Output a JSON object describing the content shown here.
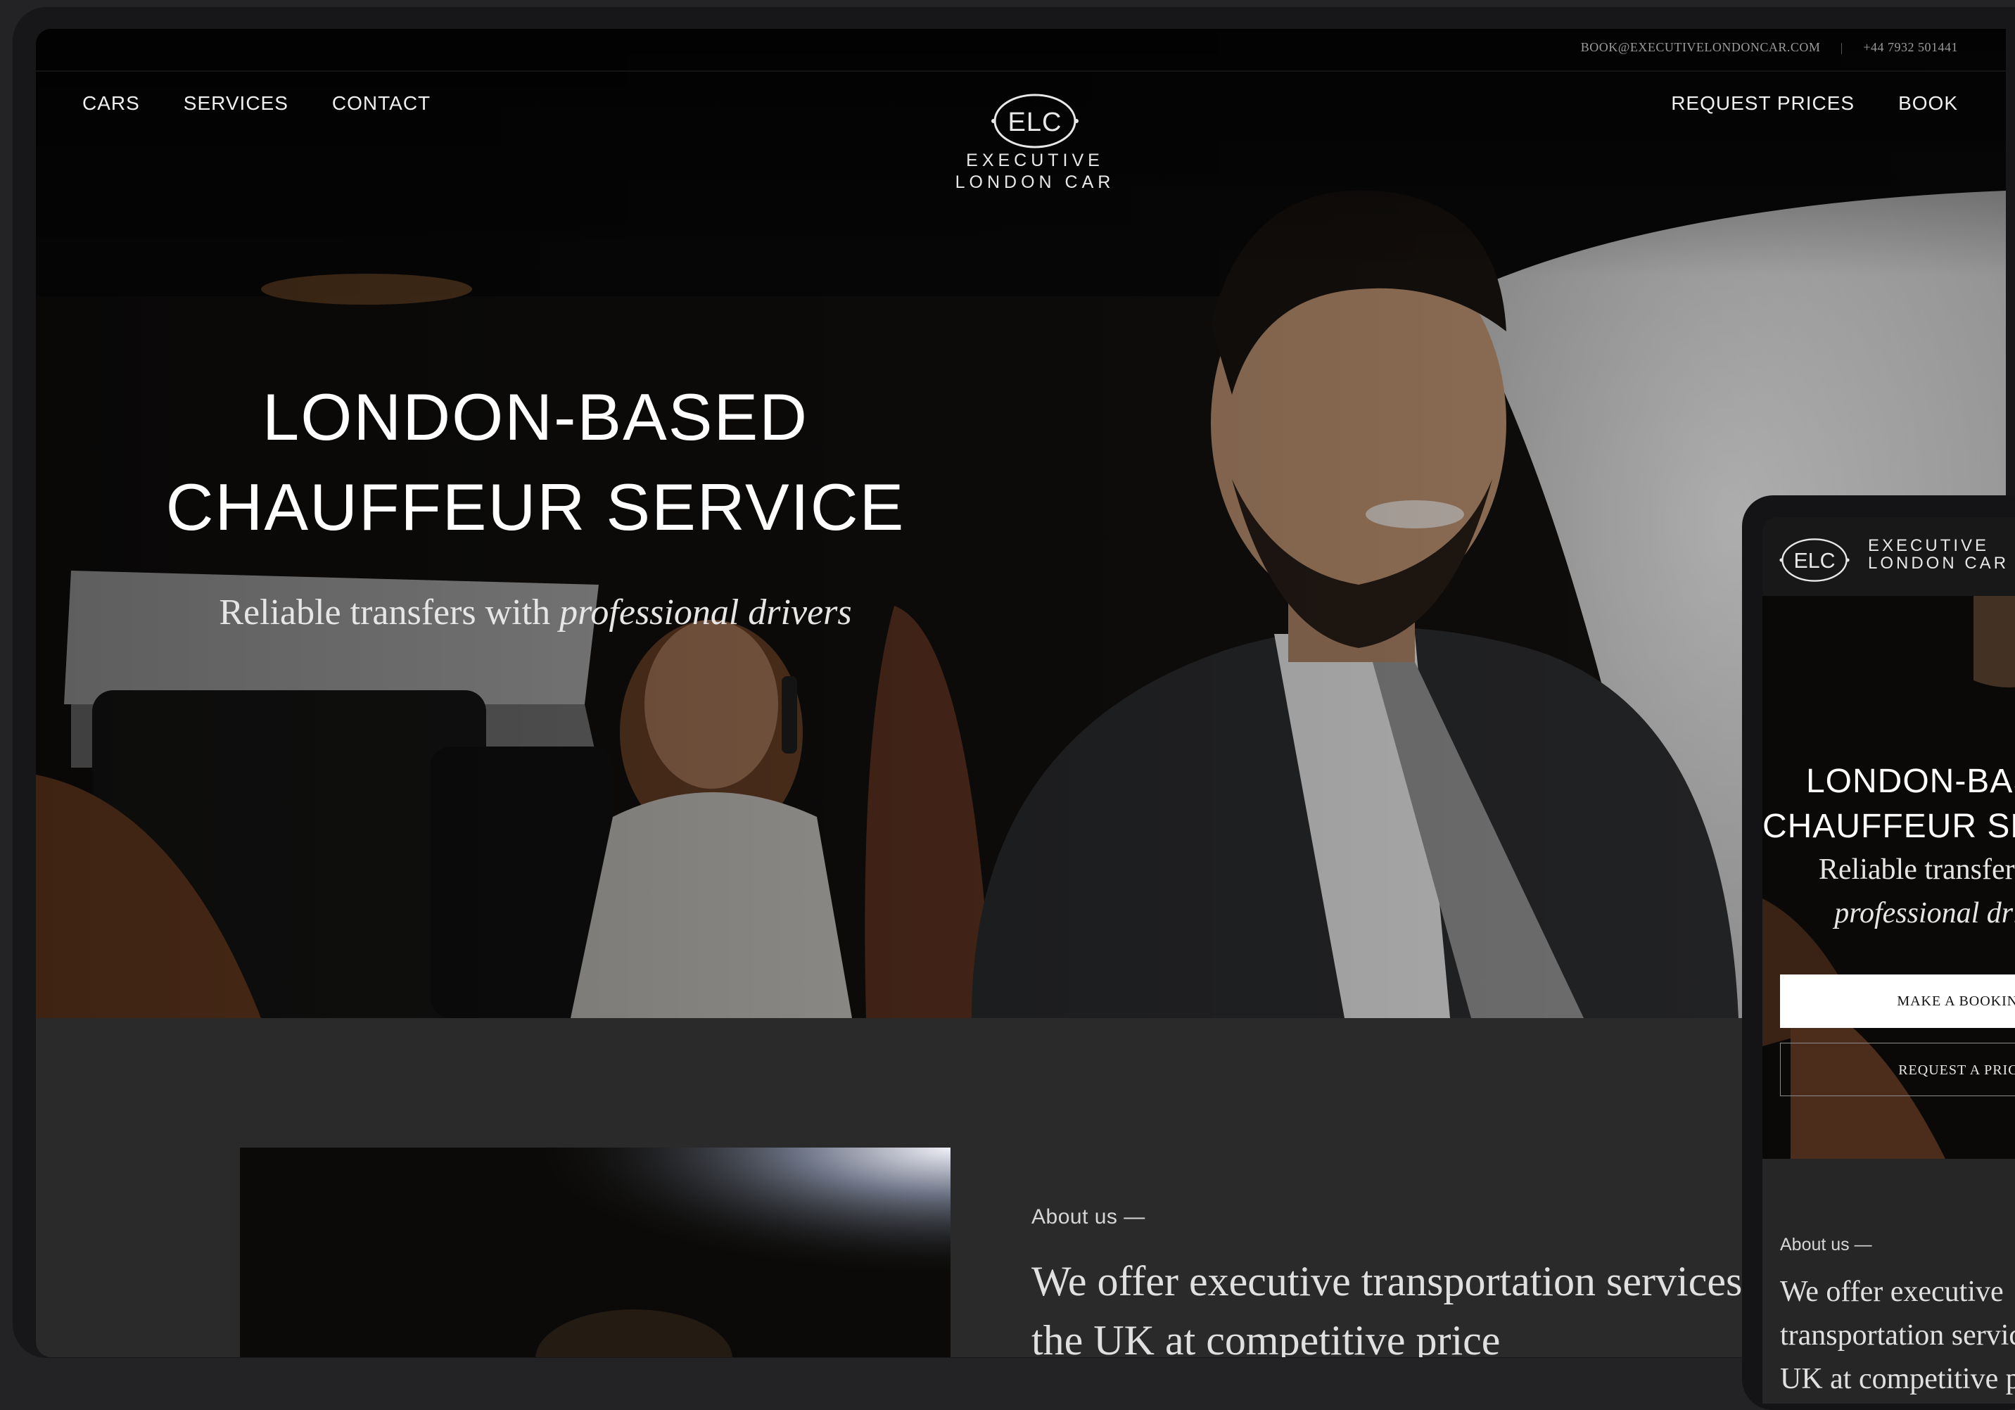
{
  "desktop": {
    "topbar": {
      "email": "BOOK@EXECUTIVELONDONCAR.COM",
      "phone": "+44 7932 501441"
    },
    "nav_left": [
      "CARS",
      "SERVICES",
      "CONTACT"
    ],
    "nav_right": [
      "REQUEST PRICES",
      "BOOK"
    ],
    "logo": {
      "mark": "ELC",
      "line1": "EXECUTIVE",
      "line2": "LONDON CAR"
    },
    "hero": {
      "title_line1": "LONDON-BASED",
      "title_line2": "CHAUFFEUR SERVICE",
      "subtitle_plain": "Reliable transfers with ",
      "subtitle_italic": "professional drivers"
    },
    "about": {
      "label": "About us —",
      "text": "We offer executive transportation services in the UK at competitive price"
    }
  },
  "mobile": {
    "logo": {
      "mark": "ELC",
      "line1": "EXECUTIVE",
      "line2": "LONDON CAR"
    },
    "hero": {
      "title_line1": "LONDON-BASED",
      "title_line2": "CHAUFFEUR SERVICE",
      "subtitle_line1": "Reliable transfers with",
      "subtitle_line2": "professional drivers"
    },
    "buttons": {
      "primary": "MAKE A BOOKING",
      "secondary": "REQUEST A PRICE"
    },
    "about": {
      "label": "About us —",
      "text": "We offer executive transportation services in the UK at competitive price"
    }
  },
  "colors": {
    "page_background": "#232325",
    "section_background": "#2a2a2a",
    "text_primary": "#ffffff",
    "button_primary_bg": "#ffffff"
  }
}
